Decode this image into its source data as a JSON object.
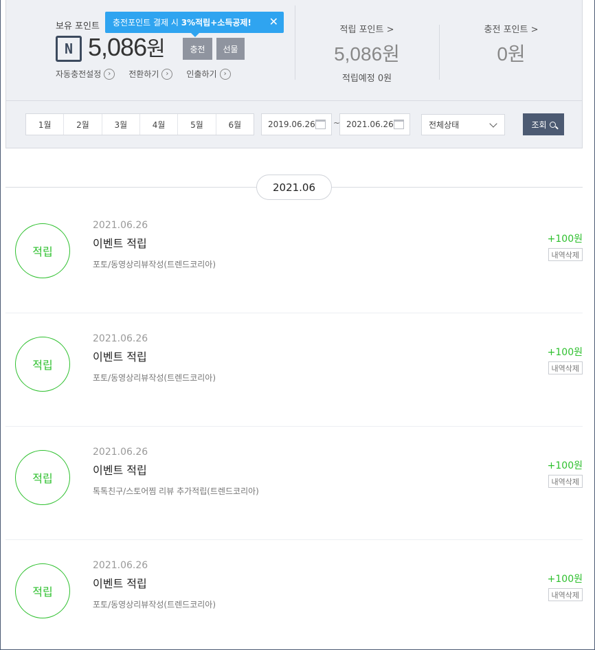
{
  "summary": {
    "own_label": "보유 포인트",
    "logo_text": "N",
    "own_value": "5,086",
    "own_unit": "원",
    "charge_label": "충전",
    "gift_label": "선물",
    "tooltip_prefix": "충전포인트 결제 시 ",
    "tooltip_bold": "3%적립+소득공제!",
    "tooltip_close": "✕",
    "links": [
      {
        "label": "자동충전설정",
        "icon": "chevron-right-icon"
      },
      {
        "label": "전환하기",
        "icon": "chevron-right-icon"
      },
      {
        "label": "인출하기",
        "icon": "chevron-right-icon"
      }
    ],
    "earned": {
      "label": "적립 포인트 >",
      "value": "5,086원",
      "sub": "적립예정 0원"
    },
    "charged": {
      "label": "충전 포인트 >",
      "value": "0원"
    }
  },
  "filter": {
    "months": [
      "1월",
      "2월",
      "3월",
      "4월",
      "5월",
      "6월"
    ],
    "date_from": "2019.06.26",
    "date_sep": "~",
    "date_to": "2021.06.26",
    "status_value": "전체상태",
    "search_label": "조회"
  },
  "month_header": "2021.06",
  "entries": [
    {
      "badge": "적립",
      "date": "2021.06.26",
      "title": "이벤트 적립",
      "desc": "포토/동영상리뷰작성(트렌드코리아)",
      "amount": "+100원",
      "delete_label": "내역삭제"
    },
    {
      "badge": "적립",
      "date": "2021.06.26",
      "title": "이벤트 적립",
      "desc": "포토/동영상리뷰작성(트렌드코리아)",
      "amount": "+100원",
      "delete_label": "내역삭제"
    },
    {
      "badge": "적립",
      "date": "2021.06.26",
      "title": "이벤트 적립",
      "desc": "톡톡친구/스토어찜 리뷰 추가적립(트렌드코리아)",
      "amount": "+100원",
      "delete_label": "내역삭제"
    },
    {
      "badge": "적립",
      "date": "2021.06.26",
      "title": "이벤트 적립",
      "desc": "포토/동영상리뷰작성(트렌드코리아)",
      "amount": "+100원",
      "delete_label": "내역삭제"
    }
  ],
  "colors": {
    "accent_green": "#2ec02e",
    "tooltip_blue": "#2fa4f0",
    "button_dark": "#4c5a72"
  }
}
